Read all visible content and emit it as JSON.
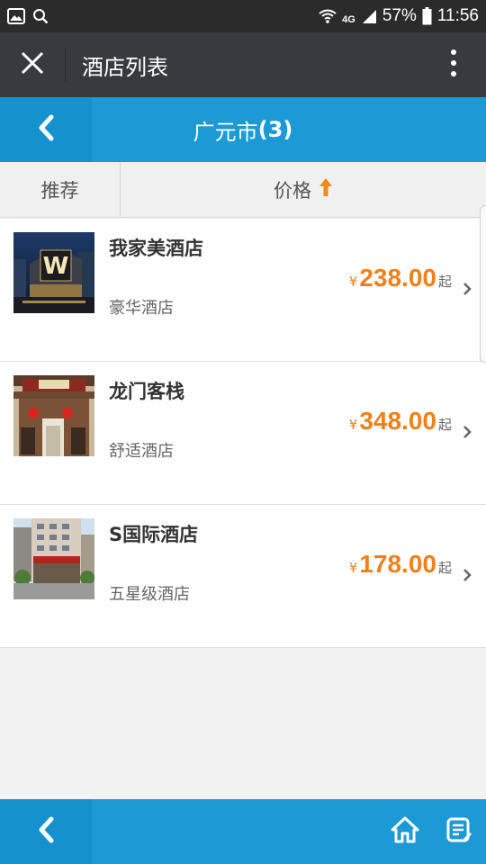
{
  "status_bar": {
    "battery": "57%",
    "time": "11:56",
    "network": "4G",
    "icons": [
      "image-icon",
      "search-icon",
      "wifi-icon",
      "signal-icon",
      "battery-icon"
    ]
  },
  "titlebar": {
    "title": "酒店列表"
  },
  "header": {
    "city": "广元市",
    "count": "(3)"
  },
  "sort": {
    "recommend": "推荐",
    "price": "价格",
    "price_order_icon": "arrow-up-icon"
  },
  "hotels": [
    {
      "name": "我家美酒店",
      "type": "豪华酒店",
      "currency": "¥",
      "price": "238.00",
      "suffix": "起"
    },
    {
      "name": "龙门客栈",
      "type": "舒适酒店",
      "currency": "¥",
      "price": "348.00",
      "suffix": "起"
    },
    {
      "name": "S国际酒店",
      "type": "五星级酒店",
      "currency": "¥",
      "price": "178.00",
      "suffix": "起"
    }
  ],
  "colors": {
    "accent_blue": "#1b9ad6",
    "price_orange": "#f0801a",
    "titlebar": "#393a3f"
  }
}
